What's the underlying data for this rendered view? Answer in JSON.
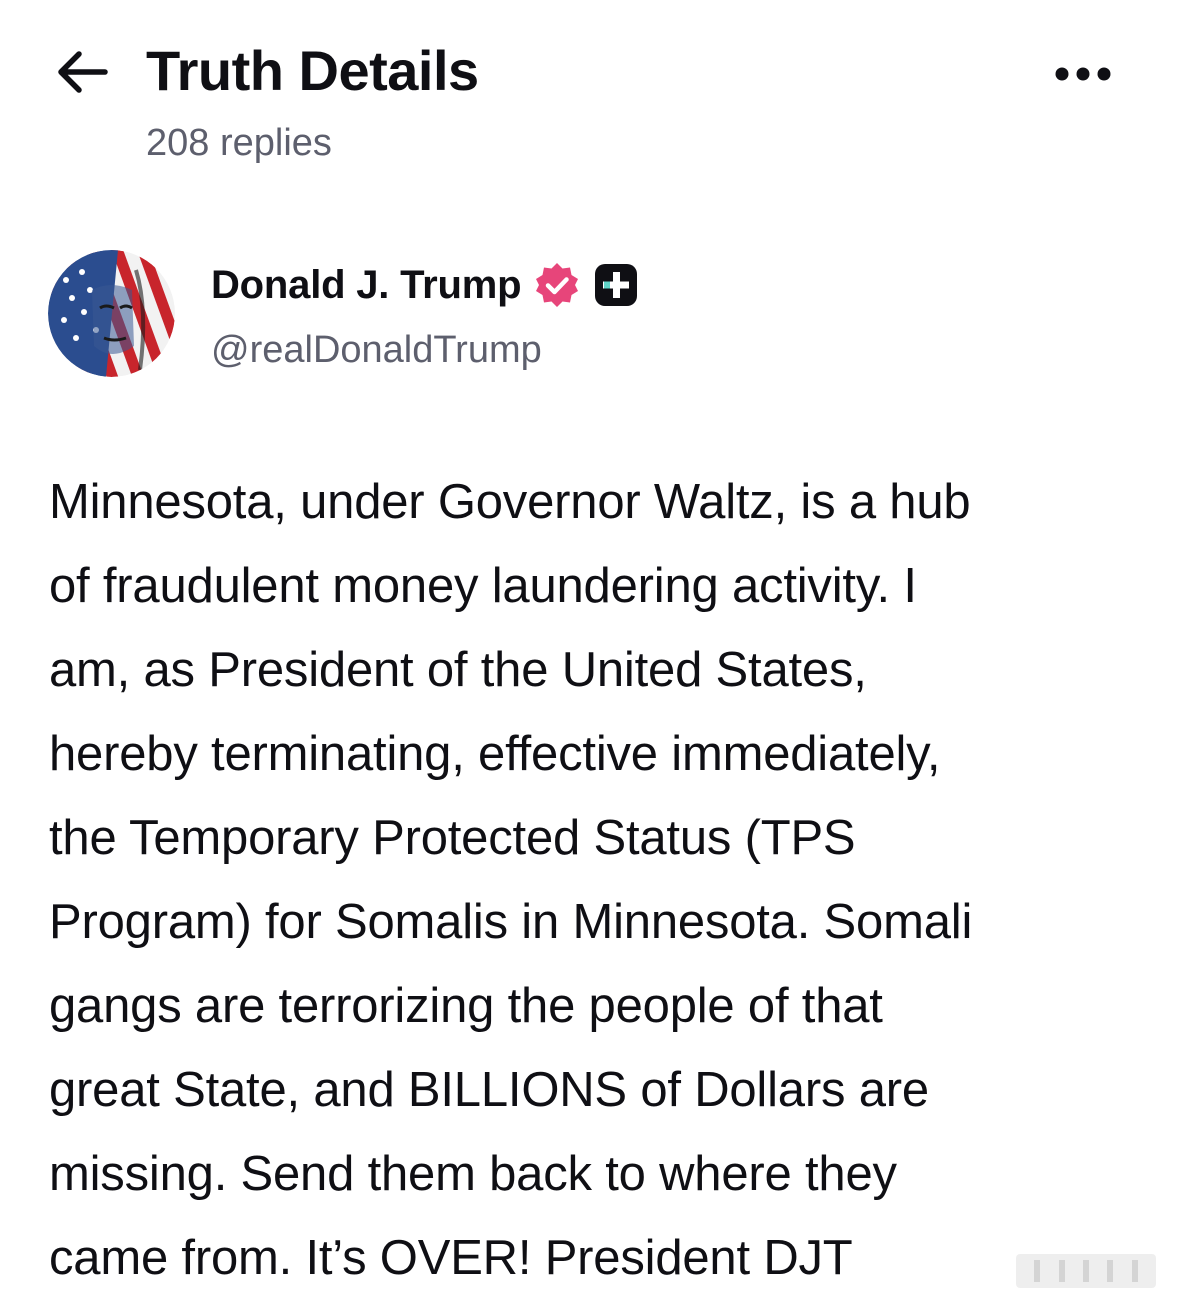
{
  "header": {
    "title": "Truth Details",
    "replies": "208 replies"
  },
  "author": {
    "name": "Donald J. Trump",
    "handle": "@realDonaldTrump",
    "verified_color": "#e7457a"
  },
  "post": {
    "lines": [
      "Minnesota, under Governor Waltz, is a hub",
      "of fraudulent money laundering activity. I",
      "am, as President of the United States,",
      "hereby terminating, effective immediately,",
      "the Temporary Protected Status (TPS",
      "Program) for Somalis in Minnesota. Somali",
      "gangs are terrorizing the people of that",
      "great State, and BILLIONS of Dollars are",
      "missing. Send them back to where they",
      "came from. It’s OVER! President DJT"
    ]
  },
  "icons": {
    "back": "arrow-left-icon",
    "more": "more-horizontal-icon",
    "verified": "verified-badge-icon",
    "plus": "truth-plus-icon"
  }
}
